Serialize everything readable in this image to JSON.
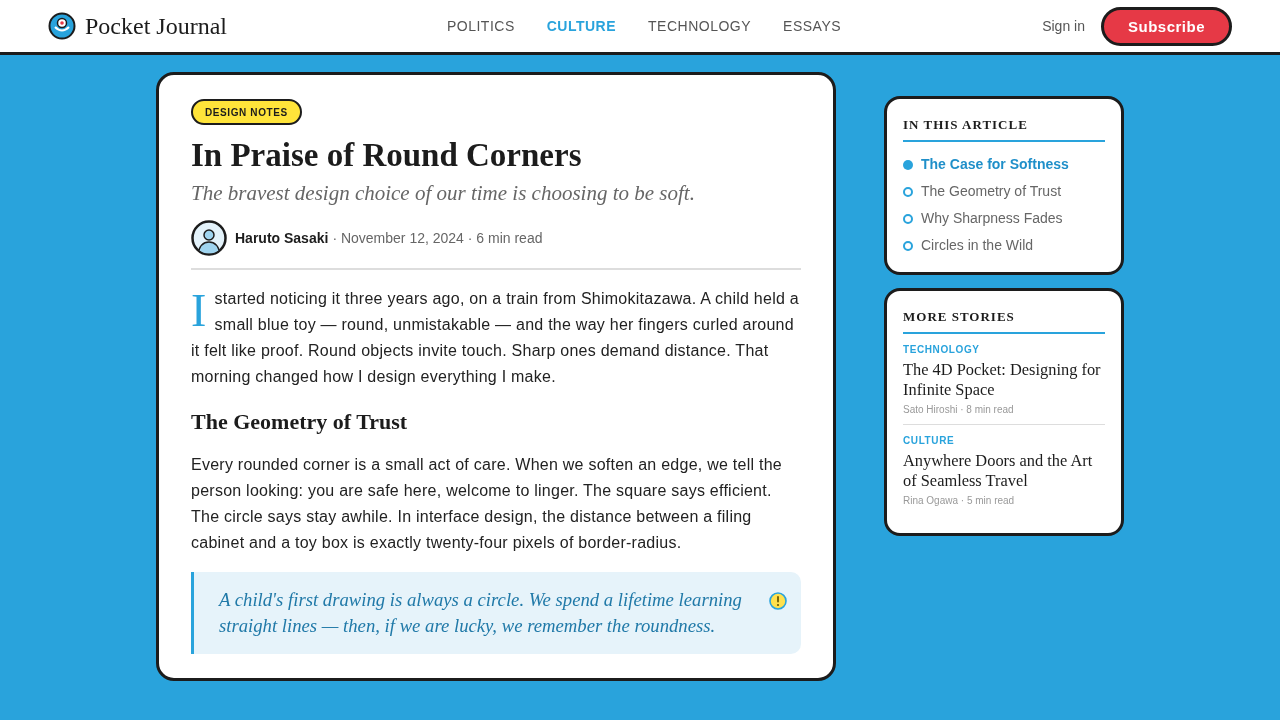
{
  "header": {
    "logo": "Pocket Journal",
    "nav": [
      {
        "label": "POLITICS",
        "selected": false
      },
      {
        "label": "CULTURE",
        "selected": true
      },
      {
        "label": "TECHNOLOGY",
        "selected": false
      },
      {
        "label": "ESSAYS",
        "selected": false
      }
    ],
    "sign_in": "Sign in",
    "subscribe": "Subscribe"
  },
  "article": {
    "tag": "DESIGN NOTES",
    "title": "In Praise of Round Corners",
    "subtitle": "The bravest design choice of our time is choosing to be soft.",
    "byline": {
      "author": "Haruto Sasaki",
      "meta": "· November 12, 2024 · 6 min read"
    },
    "body": [
      {
        "kind": "paragraph",
        "drop_cap": true,
        "text": "I started noticing it three years ago, on a train from Shimokitazawa. A child held a small blue toy — round, unmistakable — and the way her fingers curled around it felt like proof. Round objects invite touch. Sharp ones demand distance. That morning changed how I design everything I make."
      },
      {
        "kind": "heading",
        "text": "The Geometry of Trust"
      },
      {
        "kind": "paragraph",
        "drop_cap": false,
        "text": "Every rounded corner is a small act of care. When we soften an edge, we tell the person looking: you are safe here, welcome to linger. The square says efficient. The circle says stay awhile. In interface design, the distance between a filing cabinet and a toy box is exactly twenty-four pixels of border-radius."
      },
      {
        "kind": "quote",
        "text": "A child's first drawing is always a circle. We spend a lifetime learning straight lines — then, if we are lucky, we remember the roundness."
      }
    ]
  },
  "sidebar": {
    "toc": {
      "title": "IN THIS ARTICLE",
      "items": [
        {
          "label": "The Case for Softness",
          "selected": true
        },
        {
          "label": "The Geometry of Trust",
          "selected": false
        },
        {
          "label": "Why Sharpness Fades",
          "selected": false
        },
        {
          "label": "Circles in the Wild",
          "selected": false
        }
      ]
    },
    "more_stories": {
      "title": "MORE STORIES",
      "stories": [
        {
          "category": "TECHNOLOGY",
          "title": "The 4D Pocket: Designing for Infinite Space",
          "meta": "Sato Hiroshi · 8 min read"
        },
        {
          "category": "CULTURE",
          "title": "Anywhere Doors and the Art of Seamless Travel",
          "meta": "Rina Ogawa · 5 min read"
        }
      ]
    }
  }
}
